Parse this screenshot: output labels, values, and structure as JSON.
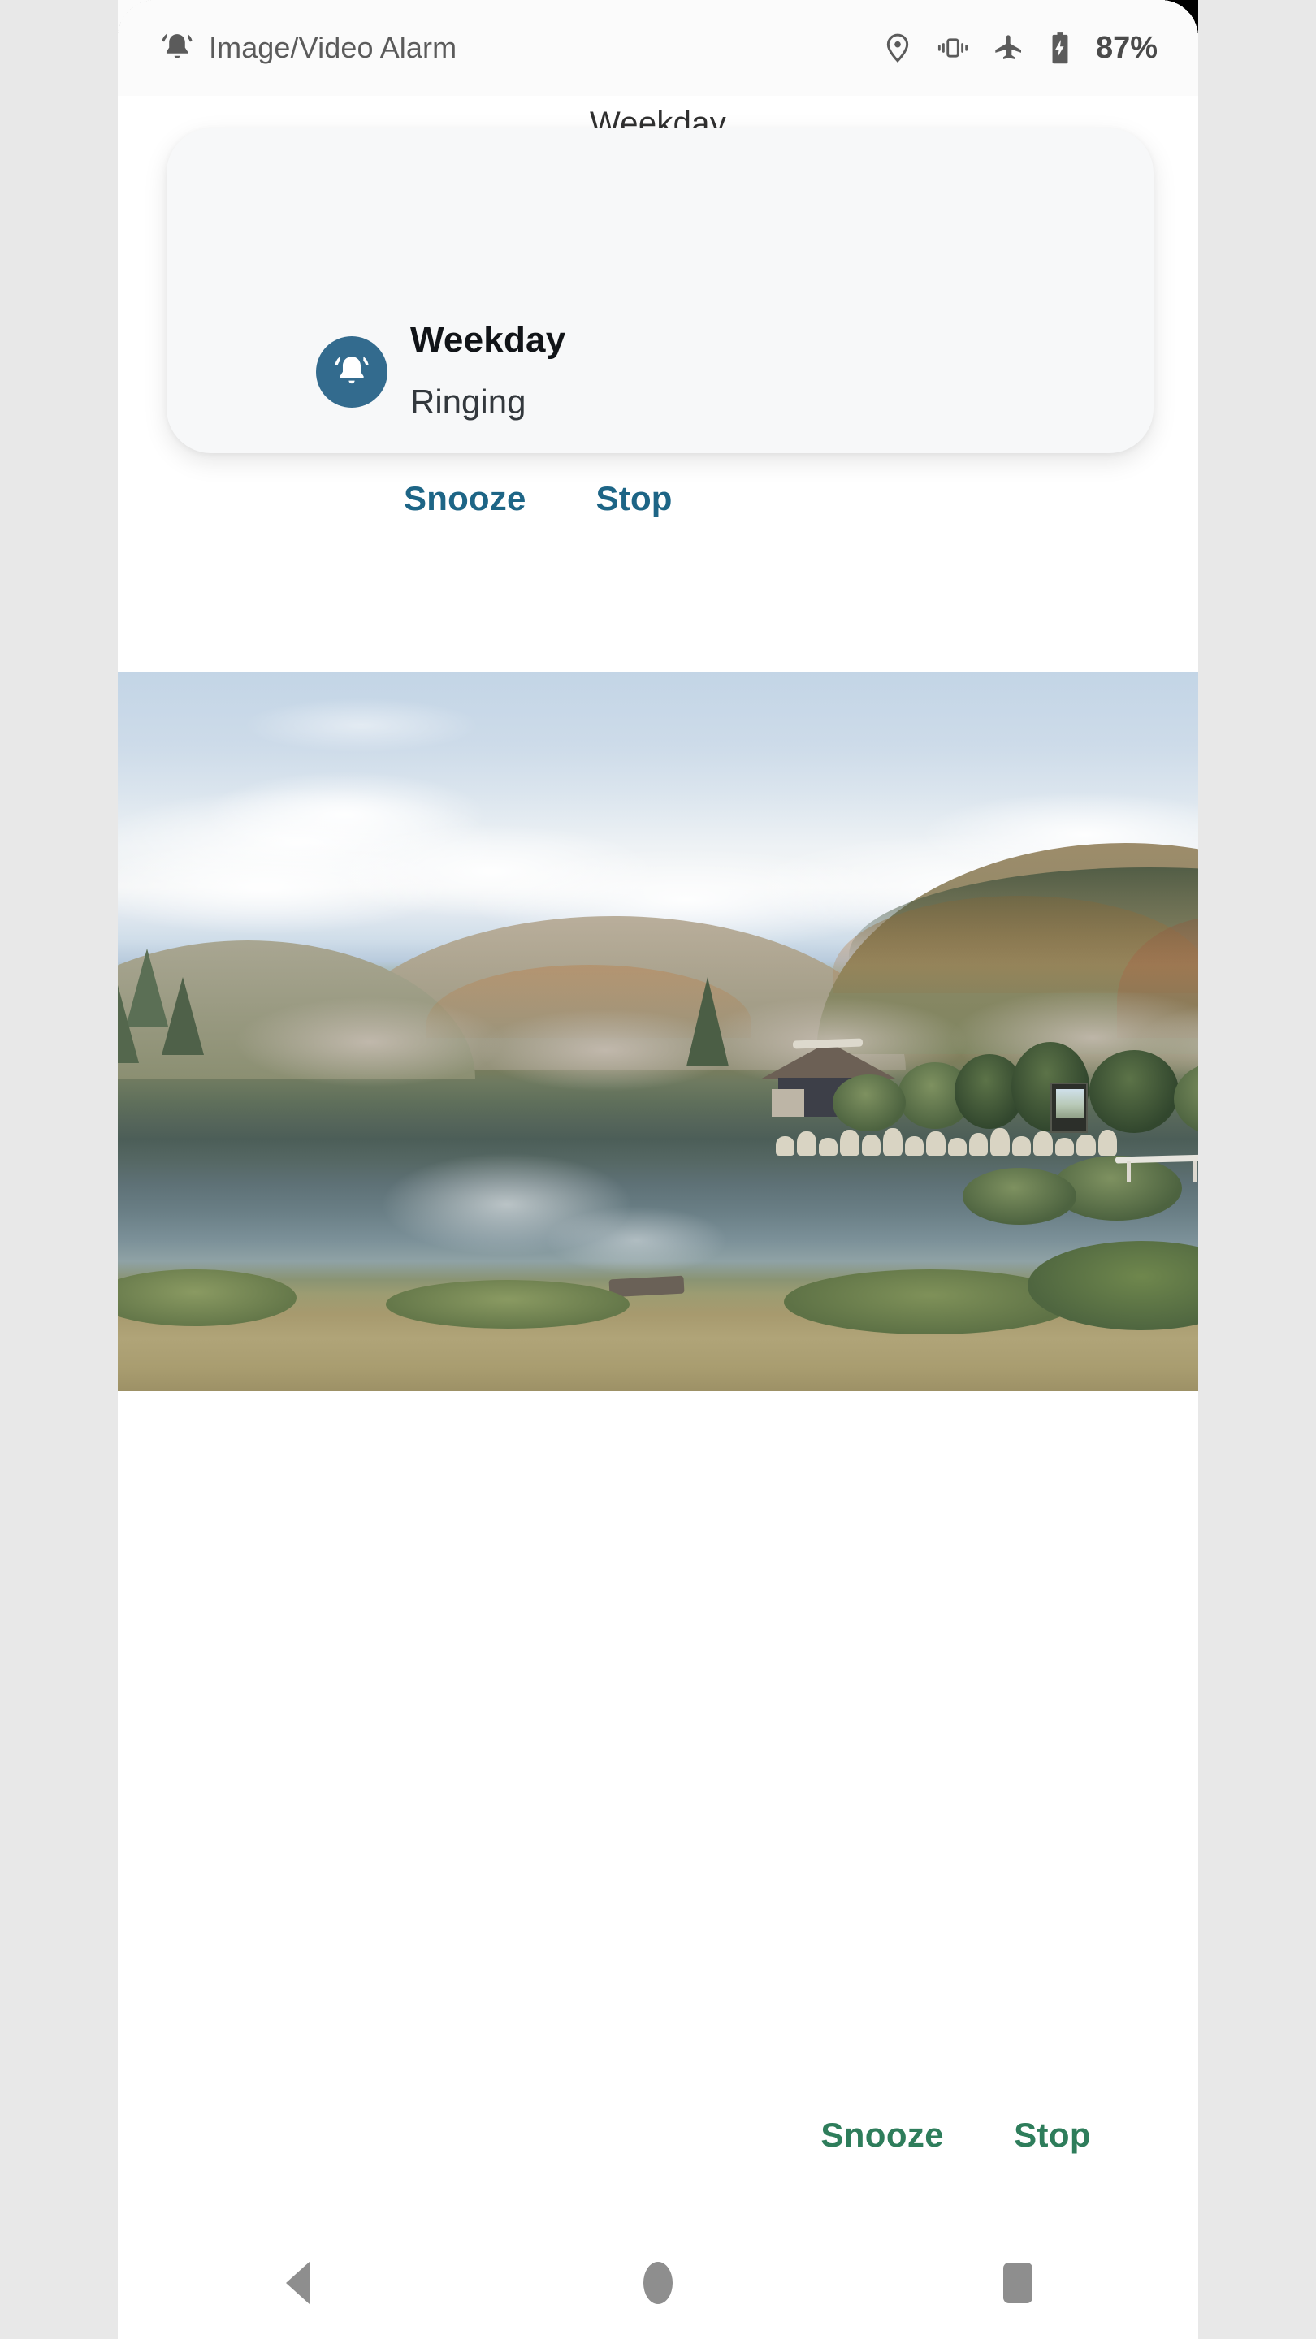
{
  "status_bar": {
    "app_icon": "bell-ringing-icon",
    "title": "Image/Video Alarm",
    "icons": [
      {
        "name": "location-icon",
        "label": "location"
      },
      {
        "name": "vibrate-icon",
        "label": "vibrate"
      },
      {
        "name": "airplane-mode-icon",
        "label": "airplane mode"
      },
      {
        "name": "battery-charging-icon",
        "label": "battery charging"
      }
    ],
    "battery_percent": "87%"
  },
  "app_screen": {
    "title": "Weekday"
  },
  "notification": {
    "icon": "bell-ringing-icon",
    "title": "Weekday",
    "subtitle": "Ringing",
    "expand_icon": "chevron-down-icon",
    "actions": [
      {
        "name": "snooze",
        "label": "Snooze"
      },
      {
        "name": "stop",
        "label": "Stop"
      }
    ],
    "accent_color": "#1d6586",
    "icon_bg_color": "#336b8e",
    "card_color": "#f7f8f9"
  },
  "photo": {
    "alt": "Autumn lakeside scene with a thatched-roof Japanese house, stone wall, pond and forested hills under a blue sky with clouds"
  },
  "bottom_actions": [
    {
      "name": "snooze",
      "label": "Snooze"
    },
    {
      "name": "stop",
      "label": "Stop"
    }
  ],
  "bottom_action_color": "#2e7d5b",
  "navigation_bar": {
    "buttons": [
      {
        "name": "back-button",
        "icon": "triangle-back-icon"
      },
      {
        "name": "home-button",
        "icon": "circle-home-icon"
      },
      {
        "name": "recents-button",
        "icon": "square-recents-icon"
      }
    ]
  }
}
